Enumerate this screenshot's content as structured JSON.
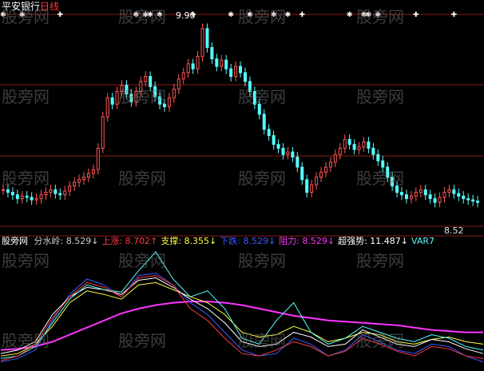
{
  "header": {
    "stock_name": "平安银行",
    "timeframe": "日线"
  },
  "main_panel": {
    "peak_label": "9.90",
    "low_label": "8.52"
  },
  "indicator_panel": {
    "title": "股旁网",
    "labels": [
      {
        "name": "分水岭",
        "value": "8.529",
        "arrow": "↓",
        "color": "#d0d0d0"
      },
      {
        "name": "上涨",
        "value": "8.702",
        "arrow": "↑",
        "color": "#ff3b3b"
      },
      {
        "name": "支撑",
        "value": "8.355",
        "arrow": "↓",
        "color": "#ffff44"
      },
      {
        "name": "下跌",
        "value": "8.529",
        "arrow": "↓",
        "color": "#3b5bff"
      },
      {
        "name": "阻力",
        "value": "8.529",
        "arrow": "↓",
        "color": "#ff33ff"
      },
      {
        "name": "超强势",
        "value": "11.487",
        "arrow": "↓",
        "color": "#ffffff"
      },
      {
        "name": "VAR7",
        "value": "",
        "arrow": "",
        "color": "#55ffff"
      }
    ]
  },
  "watermark": "股旁网",
  "colors": {
    "background": "#000000",
    "up_candle": "#ff5555",
    "down_candle": "#55ffff",
    "grid": "#8b1a1a"
  },
  "chart_data": {
    "type": "candlestick",
    "price_closes": [
      8.62,
      8.6,
      8.58,
      8.55,
      8.57,
      8.56,
      8.54,
      8.55,
      8.58,
      8.6,
      8.62,
      8.59,
      8.58,
      8.61,
      8.65,
      8.68,
      8.7,
      8.72,
      8.75,
      8.78,
      8.95,
      9.2,
      9.35,
      9.3,
      9.4,
      9.45,
      9.38,
      9.32,
      9.4,
      9.48,
      9.52,
      9.44,
      9.36,
      9.3,
      9.28,
      9.35,
      9.42,
      9.5,
      9.55,
      9.62,
      9.58,
      9.68,
      9.9,
      9.75,
      9.66,
      9.6,
      9.65,
      9.58,
      9.52,
      9.6,
      9.55,
      9.48,
      9.4,
      9.3,
      9.22,
      9.1,
      9.05,
      8.98,
      8.95,
      8.9,
      8.92,
      8.88,
      8.8,
      8.7,
      8.6,
      8.66,
      8.72,
      8.76,
      8.8,
      8.84,
      8.9,
      8.95,
      9.02,
      8.98,
      8.94,
      8.96,
      9.0,
      8.95,
      8.9,
      8.85,
      8.8,
      8.72,
      8.65,
      8.6,
      8.58,
      8.55,
      8.57,
      8.6,
      8.62,
      8.58,
      8.55,
      8.52,
      8.56,
      8.6,
      8.62,
      8.59,
      8.57,
      8.55,
      8.54,
      8.53,
      8.52
    ],
    "signal_markers": [
      {
        "x_index": 0,
        "symbol": "✱"
      },
      {
        "x_index": 4,
        "symbol": "✱"
      },
      {
        "x_index": 12,
        "symbol": "✚"
      },
      {
        "x_index": 28,
        "symbol": "✱"
      },
      {
        "x_index": 30,
        "symbol": "✱"
      },
      {
        "x_index": 31,
        "symbol": "✱"
      },
      {
        "x_index": 33,
        "symbol": "✱"
      },
      {
        "x_index": 40,
        "symbol": "✚"
      },
      {
        "x_index": 48,
        "symbol": "✱"
      },
      {
        "x_index": 52,
        "symbol": "✱"
      },
      {
        "x_index": 57,
        "symbol": "✱"
      },
      {
        "x_index": 60,
        "symbol": "✱"
      },
      {
        "x_index": 63,
        "symbol": "✚"
      },
      {
        "x_index": 73,
        "symbol": "✱"
      },
      {
        "x_index": 76,
        "symbol": "✱"
      },
      {
        "x_index": 77,
        "symbol": "✱"
      },
      {
        "x_index": 79,
        "symbol": "✱"
      },
      {
        "x_index": 87,
        "symbol": "✚"
      },
      {
        "x_index": 95,
        "symbol": "✚"
      }
    ],
    "indicator_series": [
      {
        "key": "magenta_line",
        "values": [
          0.15,
          0.16,
          0.18,
          0.22,
          0.28,
          0.34,
          0.4,
          0.46,
          0.5,
          0.53,
          0.55,
          0.56,
          0.56,
          0.55,
          0.53,
          0.5,
          0.47,
          0.44,
          0.42,
          0.4,
          0.39,
          0.38,
          0.37,
          0.36,
          0.34,
          0.32,
          0.31,
          0.3,
          0.3
        ]
      },
      {
        "key": "yellow_line",
        "values": [
          0.1,
          0.12,
          0.2,
          0.35,
          0.55,
          0.65,
          0.62,
          0.58,
          0.7,
          0.72,
          0.66,
          0.6,
          0.55,
          0.45,
          0.3,
          0.26,
          0.28,
          0.35,
          0.3,
          0.22,
          0.25,
          0.3,
          0.28,
          0.22,
          0.2,
          0.24,
          0.26,
          0.22,
          0.2
        ]
      },
      {
        "key": "blue_line",
        "values": [
          0.05,
          0.08,
          0.15,
          0.4,
          0.62,
          0.75,
          0.7,
          0.6,
          0.78,
          0.8,
          0.7,
          0.55,
          0.45,
          0.3,
          0.15,
          0.1,
          0.12,
          0.25,
          0.2,
          0.1,
          0.15,
          0.28,
          0.22,
          0.15,
          0.12,
          0.2,
          0.18,
          0.1,
          0.05
        ]
      },
      {
        "key": "white_line",
        "values": [
          0.12,
          0.15,
          0.22,
          0.45,
          0.6,
          0.68,
          0.66,
          0.62,
          0.74,
          0.76,
          0.68,
          0.58,
          0.5,
          0.38,
          0.22,
          0.18,
          0.2,
          0.3,
          0.26,
          0.18,
          0.2,
          0.32,
          0.26,
          0.2,
          0.18,
          0.24,
          0.22,
          0.16,
          0.12
        ]
      },
      {
        "key": "cyan_line",
        "values": [
          0.08,
          0.1,
          0.18,
          0.38,
          0.58,
          0.7,
          0.66,
          0.64,
          0.82,
          0.98,
          0.75,
          0.6,
          0.65,
          0.5,
          0.25,
          0.2,
          0.4,
          0.55,
          0.3,
          0.2,
          0.25,
          0.35,
          0.3,
          0.25,
          0.22,
          0.28,
          0.25,
          0.18,
          0.15
        ]
      },
      {
        "key": "red_line",
        "values": [
          0.06,
          0.1,
          0.2,
          0.42,
          0.6,
          0.72,
          0.68,
          0.6,
          0.76,
          0.78,
          0.7,
          0.5,
          0.4,
          0.25,
          0.12,
          0.1,
          0.15,
          0.22,
          0.18,
          0.1,
          0.14,
          0.25,
          0.2,
          0.14,
          0.1,
          0.18,
          0.16,
          0.1,
          0.08
        ]
      }
    ]
  }
}
